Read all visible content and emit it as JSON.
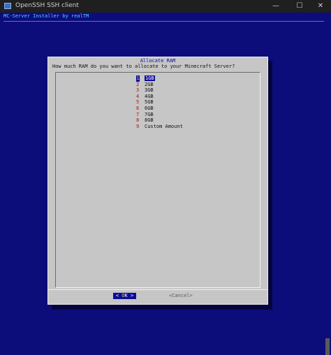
{
  "window": {
    "title": "OpenSSH SSH client"
  },
  "window_controls": {
    "minimize": "—",
    "maximize": "☐",
    "close": "✕"
  },
  "terminal": {
    "heading": "MC-Server Installer by realTM"
  },
  "dialog": {
    "title": "Allocate RAM",
    "question": "How much RAM do you want to allocate to your Minecraft Server?",
    "items": [
      {
        "num": "1",
        "label": "1GB"
      },
      {
        "num": "2",
        "label": "2GB"
      },
      {
        "num": "3",
        "label": "3GB"
      },
      {
        "num": "4",
        "label": "4GB"
      },
      {
        "num": "5",
        "label": "5GB"
      },
      {
        "num": "6",
        "label": "6GB"
      },
      {
        "num": "7",
        "label": "7GB"
      },
      {
        "num": "8",
        "label": "8GB"
      },
      {
        "num": "9",
        "label": "Custom Amount"
      }
    ],
    "selected": "1",
    "buttons": {
      "ok_left": "<",
      "ok_hot": "O",
      "ok_rest": "K",
      "ok_right": ">",
      "cancel": "<Cancel>"
    }
  }
}
